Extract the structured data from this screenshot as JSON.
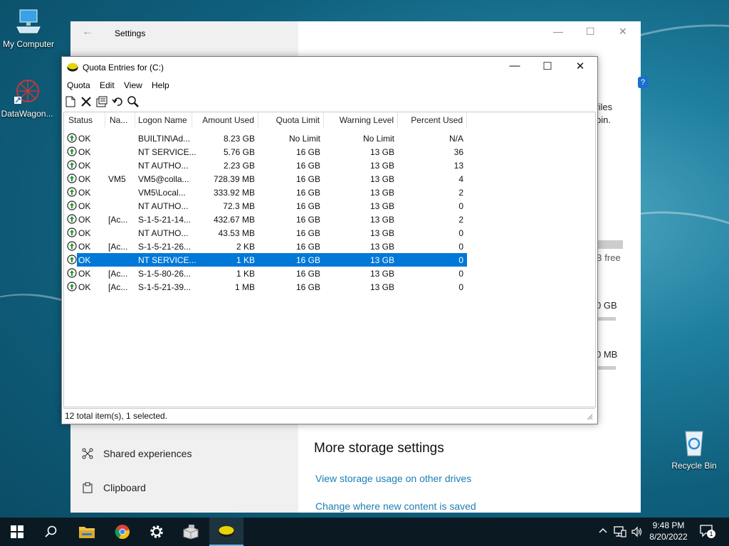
{
  "desktop": {
    "icons": [
      {
        "label": "My Computer"
      },
      {
        "label": "DataWagon..."
      },
      {
        "label": "Recycle Bin"
      }
    ]
  },
  "settings": {
    "title": "Settings",
    "nav": [
      {
        "label": "Shared experiences"
      },
      {
        "label": "Clipboard"
      }
    ],
    "more_storage_heading": "More storage settings",
    "links": [
      "View storage usage on other drives",
      "Change where new content is saved"
    ],
    "fragments": [
      "files",
      "bin.",
      "B free",
      "0 GB",
      "0 MB"
    ]
  },
  "quota": {
    "title": "Quota Entries for  (C:)",
    "menu": [
      "Quota",
      "Edit",
      "View",
      "Help"
    ],
    "columns": [
      "Status",
      "Na...",
      "Logon Name",
      "Amount Used",
      "Quota Limit",
      "Warning Level",
      "Percent Used"
    ],
    "rows": [
      {
        "status": "OK",
        "name": "",
        "logon": "BUILTIN\\Ad...",
        "used": "8.23 GB",
        "limit": "No Limit",
        "warning": "No Limit",
        "percent": "N/A"
      },
      {
        "status": "OK",
        "name": "",
        "logon": "NT SERVICE...",
        "used": "5.76 GB",
        "limit": "16 GB",
        "warning": "13 GB",
        "percent": "36"
      },
      {
        "status": "OK",
        "name": "",
        "logon": "NT AUTHO...",
        "used": "2.23 GB",
        "limit": "16 GB",
        "warning": "13 GB",
        "percent": "13"
      },
      {
        "status": "OK",
        "name": "VM5",
        "logon": "VM5@colla...",
        "used": "728.39 MB",
        "limit": "16 GB",
        "warning": "13 GB",
        "percent": "4"
      },
      {
        "status": "OK",
        "name": "",
        "logon": "VM5\\Local...",
        "used": "333.92 MB",
        "limit": "16 GB",
        "warning": "13 GB",
        "percent": "2"
      },
      {
        "status": "OK",
        "name": "",
        "logon": "NT AUTHO...",
        "used": "72.3 MB",
        "limit": "16 GB",
        "warning": "13 GB",
        "percent": "0"
      },
      {
        "status": "OK",
        "name": "[Ac...",
        "logon": "S-1-5-21-14...",
        "used": "432.67 MB",
        "limit": "16 GB",
        "warning": "13 GB",
        "percent": "2"
      },
      {
        "status": "OK",
        "name": "",
        "logon": "NT AUTHO...",
        "used": "43.53 MB",
        "limit": "16 GB",
        "warning": "13 GB",
        "percent": "0"
      },
      {
        "status": "OK",
        "name": "[Ac...",
        "logon": "S-1-5-21-26...",
        "used": "2 KB",
        "limit": "16 GB",
        "warning": "13 GB",
        "percent": "0"
      },
      {
        "status": "OK",
        "name": "",
        "logon": "NT SERVICE...",
        "used": "1 KB",
        "limit": "16 GB",
        "warning": "13 GB",
        "percent": "0",
        "selected": true
      },
      {
        "status": "OK",
        "name": "[Ac...",
        "logon": "S-1-5-80-26...",
        "used": "1 KB",
        "limit": "16 GB",
        "warning": "13 GB",
        "percent": "0"
      },
      {
        "status": "OK",
        "name": "[Ac...",
        "logon": "S-1-5-21-39...",
        "used": "1 MB",
        "limit": "16 GB",
        "warning": "13 GB",
        "percent": "0"
      }
    ],
    "status_text": "12 total item(s), 1 selected."
  },
  "taskbar": {
    "time": "9:48 PM",
    "date": "8/20/2022",
    "notification_count": "1"
  },
  "colors": {
    "selection": "#0078d7",
    "link": "#1a7fb5",
    "taskbar": "#0b1a22"
  }
}
